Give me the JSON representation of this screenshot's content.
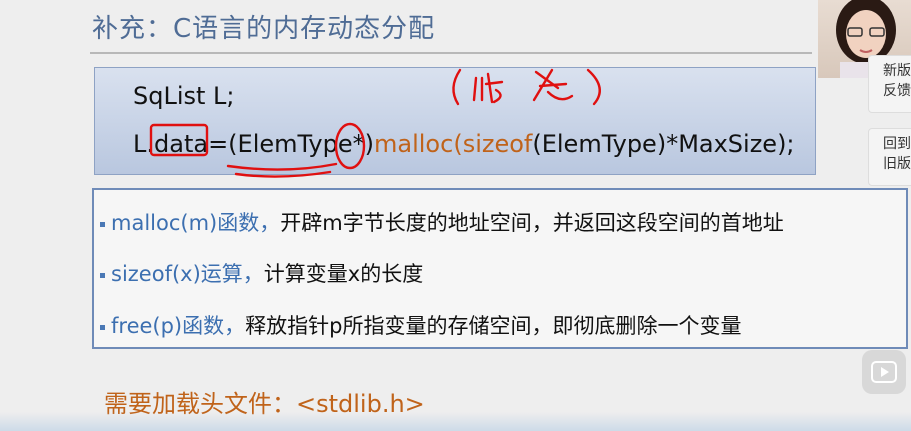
{
  "slide": {
    "title": "补充：C语言的内存动态分配",
    "code": {
      "line1": "SqList L;",
      "line2": {
        "var": "L.data",
        "eq": "=",
        "cast": "(ElemType*)",
        "malloc": "malloc",
        "paren_open": "(",
        "sizeof": "sizeof",
        "arg": "(ElemType)*MaxSize);"
      }
    },
    "bullets": [
      {
        "fn": "malloc(m)函数，",
        "desc": "开辟m字节长度的地址空间，并返回这段空间的首地址"
      },
      {
        "fn": "sizeof(x)运算，",
        "desc": "计算变量x的长度"
      },
      {
        "fn": "free(p)函数，",
        "desc": "释放指针p所指变量的存储空间，即彻底删除一个变量"
      }
    ],
    "footer": "需要加载头文件：<stdlib.h>"
  },
  "side_panel": {
    "new_version": "新版\n反馈",
    "old_version": "回到\n旧版"
  },
  "annotation": {
    "handwritten_note": "(ints 大)",
    "ink_color": "#e01010"
  }
}
